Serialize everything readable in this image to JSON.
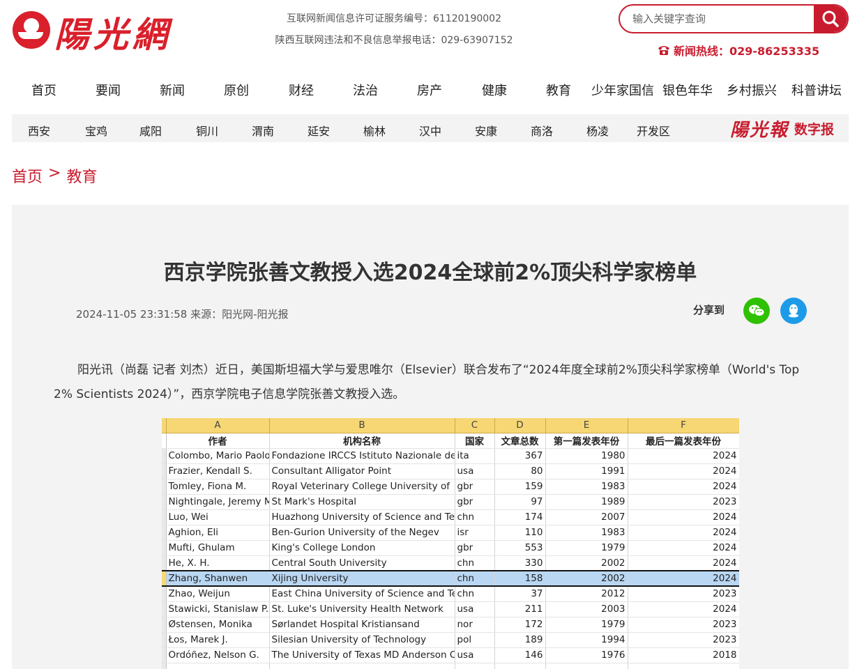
{
  "header": {
    "logo_text": "陽光網",
    "license_line1": "互联网新闻信息许可证服务编号：61120190002",
    "license_line2": "陕西互联网违法和不良信息举报电话：029-63907152",
    "search_placeholder": "输入关键字查询",
    "hotline": "新闻热线：029-86253335"
  },
  "main_nav": [
    "首页",
    "要闻",
    "新闻",
    "原创",
    "财经",
    "法治",
    "房产",
    "健康",
    "教育",
    "少年家国信",
    "银色年华",
    "乡村振兴",
    "科普讲坛"
  ],
  "region_nav": [
    "西安",
    "宝鸡",
    "咸阳",
    "铜川",
    "渭南",
    "延安",
    "榆林",
    "汉中",
    "安康",
    "商洛",
    "杨凌",
    "开发区"
  ],
  "digital_paper": {
    "logo": "陽光報",
    "label": "数字报"
  },
  "breadcrumb": {
    "home": "首页",
    "sep": ">",
    "section": "教育"
  },
  "article": {
    "title": "西京学院张善文教授入选2024全球前2%顶尖科学家榜单",
    "meta": "2024-11-05 23:31:58 来源：阳光网-阳光报",
    "share_label": "分享到",
    "paragraph": "阳光讯（尚磊 记者 刘杰）近日，美国斯坦福大学与爱思唯尔（Elsevier）联合发布了“2024年度全球前2%顶尖科学家榜单（World's Top 2% Scientists 2024）”，西京学院电子信息学院张善文教授入选。"
  },
  "sheet": {
    "col_letters": [
      "A",
      "B",
      "C",
      "D",
      "E",
      "F"
    ],
    "headers": [
      "作者",
      "机构名称",
      "国家",
      "文章总数",
      "第一篇发表年份",
      "最后一篇发表年份"
    ],
    "rows": [
      [
        "Colombo, Mario Paolo",
        "Fondazione IRCCS Istituto Nazionale dei",
        "ita",
        "367",
        "1980",
        "2024"
      ],
      [
        "Frazier, Kendall S.",
        "Consultant Alligator Point",
        "usa",
        "80",
        "1991",
        "2024"
      ],
      [
        "Tomley, Fiona M.",
        "Royal Veterinary College University of",
        "gbr",
        "159",
        "1983",
        "2024"
      ],
      [
        "Nightingale, Jeremy M",
        "St Mark's Hospital",
        "gbr",
        "97",
        "1989",
        "2023"
      ],
      [
        "Luo, Wei",
        "Huazhong University of Science and Tech",
        "chn",
        "174",
        "2007",
        "2024"
      ],
      [
        "Aghion, Eli",
        "Ben-Gurion University of the Negev",
        "isr",
        "110",
        "1983",
        "2024"
      ],
      [
        "Mufti, Ghulam",
        "King's College London",
        "gbr",
        "553",
        "1979",
        "2024"
      ],
      [
        "He, X. H.",
        "Central South University",
        "chn",
        "330",
        "2002",
        "2024"
      ],
      [
        "Zhang, Shanwen",
        "Xijing University",
        "chn",
        "158",
        "2002",
        "2024"
      ],
      [
        "Zhao, Weijun",
        "East China University of Science and Tech",
        "chn",
        "37",
        "2012",
        "2023"
      ],
      [
        "Stawicki, Stanislaw P.",
        "St. Luke's University Health Network",
        "usa",
        "211",
        "2003",
        "2024"
      ],
      [
        "Østensen, Monika",
        "Sørlandet Hospital Kristiansand",
        "nor",
        "172",
        "1979",
        "2023"
      ],
      [
        "Łos, Marek J.",
        "Silesian University of Technology",
        "pol",
        "189",
        "1994",
        "2023"
      ],
      [
        "Ordóñez, Nelson G.",
        "The University of Texas MD Anderson C",
        "usa",
        "146",
        "1976",
        "2018"
      ],
      [
        "",
        "",
        "",
        "",
        "",
        ""
      ]
    ],
    "selected_row": 8
  },
  "colors": {
    "brand_red": "#c81c2e",
    "wechat": "#2dc100",
    "qq": "#1e9be8",
    "sheet_header": "#f7d774",
    "selection": "#b9d7f2"
  }
}
